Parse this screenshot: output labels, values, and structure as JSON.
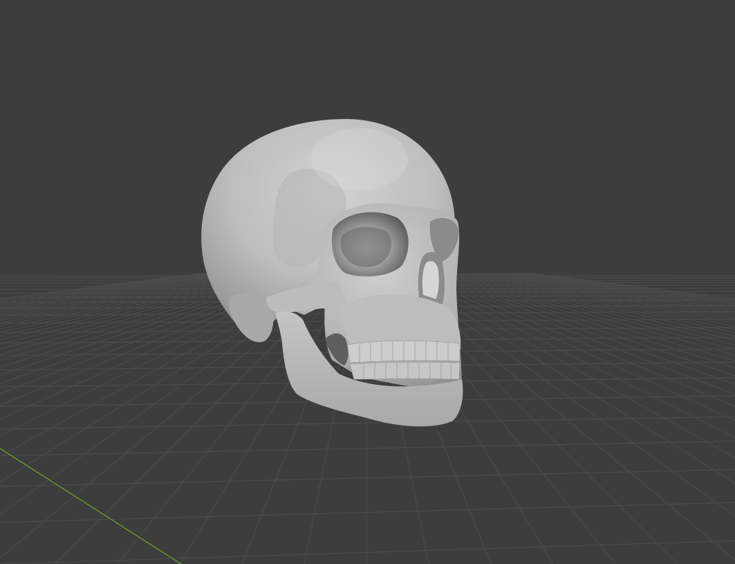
{
  "viewport": {
    "background_color": "#3d3d3d",
    "grid_color": "#4c4c4c",
    "x_axis_color": "#6e9a2c",
    "model_color": "#c4c4c4",
    "model": "skull-mesh"
  }
}
